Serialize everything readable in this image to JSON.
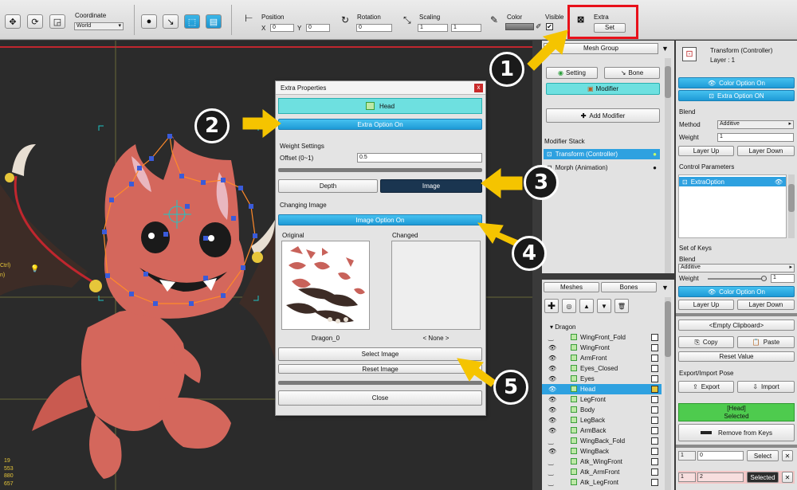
{
  "toolbar": {
    "coordinate_label": "Coordinate",
    "coordinate_value": "World",
    "position_label": "Position",
    "pos_x_label": "X",
    "pos_x": "0",
    "pos_y_label": "Y",
    "pos_y": "0",
    "rotation_label": "Rotation",
    "rotation": "0",
    "scaling_label": "Scaling",
    "scale_x": "1",
    "scale_y": "1",
    "color_label": "Color",
    "visible_label": "Visible",
    "extra_label": "Extra",
    "set_label": "Set"
  },
  "status_numbers": [
    "19",
    "553",
    "880",
    "657"
  ],
  "viewport_side_text": [
    "Ctrl)",
    "n)"
  ],
  "dialog": {
    "title": "Extra Properties",
    "close_x": "x",
    "head_label": "Head",
    "extra_option": "Extra Option On",
    "weight_settings": "Weight Settings",
    "offset_label": "Offset (0~1)",
    "offset_value": "0.5",
    "depth_tab": "Depth",
    "image_tab": "Image",
    "changing_image": "Changing Image",
    "image_option": "Image Option On",
    "original_label": "Original",
    "changed_label": "Changed",
    "original_name": "Dragon_0",
    "changed_name": "< None >",
    "select_image": "Select Image",
    "reset_image": "Reset Image",
    "close": "Close"
  },
  "mesh_group": {
    "title": "Mesh Group",
    "setting": "Setting",
    "bone": "Bone",
    "modifier": "Modifier",
    "add_modifier": "Add Modifier",
    "modifier_stack": "Modifier Stack",
    "stack": [
      "Transform (Controller)",
      "Morph (Animation)"
    ]
  },
  "hierarchy": {
    "tabs": [
      "Meshes",
      "Bones"
    ],
    "root": "Dragon",
    "items": [
      "WingFront_Fold",
      "WingFront",
      "ArmFront",
      "Eyes_Closed",
      "Eyes",
      "Head",
      "LegFront",
      "Body",
      "LegBack",
      "ArmBack",
      "WingBack_Fold",
      "WingBack",
      "Atk_WingFront",
      "Atk_ArmFront",
      "Atk_LegFront"
    ],
    "selected": "Head"
  },
  "right_panel": {
    "title": "Transform (Controller)",
    "layer": "Layer : 1",
    "color_option": "Color Option On",
    "extra_option": "Extra Option ON",
    "blend_label": "Blend",
    "method_label": "Method",
    "method_value": "Additive",
    "weight_label": "Weight",
    "weight_value": "1",
    "layer_up": "Layer Up",
    "layer_down": "Layer Down",
    "control_params": "Control Parameters",
    "param_item": "ExtraOption",
    "set_of_keys": "Set of Keys",
    "blend2_label": "Blend",
    "blend2_value": "Additive",
    "weight2_label": "Weight",
    "weight2_value": "1",
    "color_option2": "Color Option On",
    "layer_up2": "Layer Up",
    "layer_down2": "Layer Down",
    "empty_clipboard": "<Empty Clipboard>",
    "copy": "Copy",
    "paste": "Paste",
    "reset_value": "Reset Value",
    "export_import": "Export/Import Pose",
    "export": "Export",
    "import": "Import",
    "selected_name": "[Head]",
    "selected_word": "Selected",
    "remove_keys": "Remove from Keys",
    "key_rows": [
      {
        "a": "1",
        "b": "0",
        "btn": "Select"
      },
      {
        "a": "1",
        "b": "2",
        "btn": "Selected"
      }
    ]
  },
  "callouts": [
    "1",
    "2",
    "3",
    "4",
    "5"
  ],
  "colors": {
    "accent": "#1e9ad6",
    "cyan": "#6ee0e0",
    "highlight_red": "#e8101a",
    "arrow": "#f5c400",
    "selected_green": "#4ecb4e"
  }
}
